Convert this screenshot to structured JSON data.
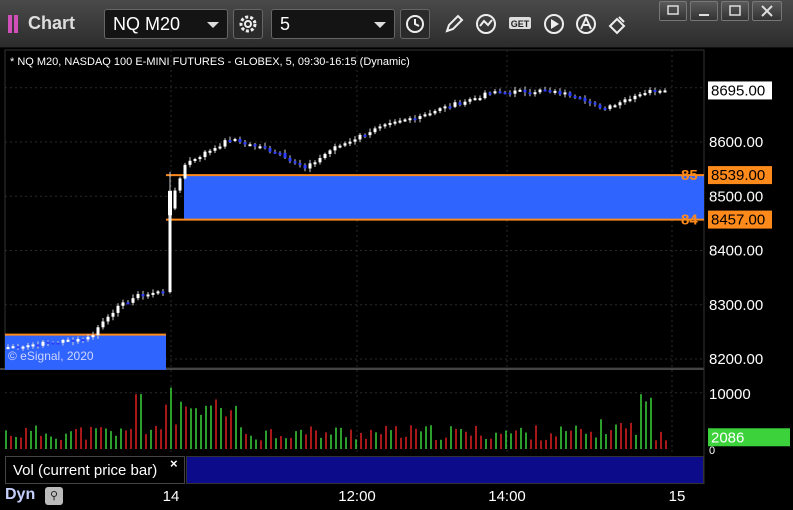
{
  "window": {
    "title": "Chart"
  },
  "toolbar": {
    "symbol": "NQ M20",
    "interval": "5",
    "icons": [
      "time-icon",
      "pencil-icon",
      "study-icon",
      "get-icon",
      "play-icon",
      "alert-icon",
      "link-icon"
    ]
  },
  "chart": {
    "header": "* NQ M20, NASDAQ 100 E-MINI FUTURES - GLOBEX, 5, 09:30-16:15 (Dynamic)",
    "copyright": "© eSignal, 2020",
    "last_price": "8695.00",
    "y_ticks": [
      "8600.00",
      "8500.00",
      "8400.00",
      "8300.00",
      "8200.00"
    ],
    "levels": [
      {
        "label": "85",
        "value": "8539.00"
      },
      {
        "label": "84",
        "value": "8457.00"
      }
    ],
    "colors": {
      "up": "#ffffff",
      "down": "#2a3cff",
      "band": "#2f64ff",
      "level": "#ff8a1c",
      "vol_up": "#3bd23b",
      "vol_down": "#e02020"
    }
  },
  "volume": {
    "y_ticks": [
      "10000",
      "0"
    ],
    "current": "2086",
    "label": "Vol (current price bar)",
    "close": "×"
  },
  "footer": {
    "mode": "Dyn",
    "time_labels": [
      "14",
      "12:00",
      "14:00",
      "15"
    ]
  },
  "chart_data": {
    "type": "candlestick",
    "price_range": [
      8180,
      8740
    ],
    "day1_close_approx": 8320,
    "day2_range_approx": [
      8525,
      8705
    ],
    "volume_max": 10000
  }
}
